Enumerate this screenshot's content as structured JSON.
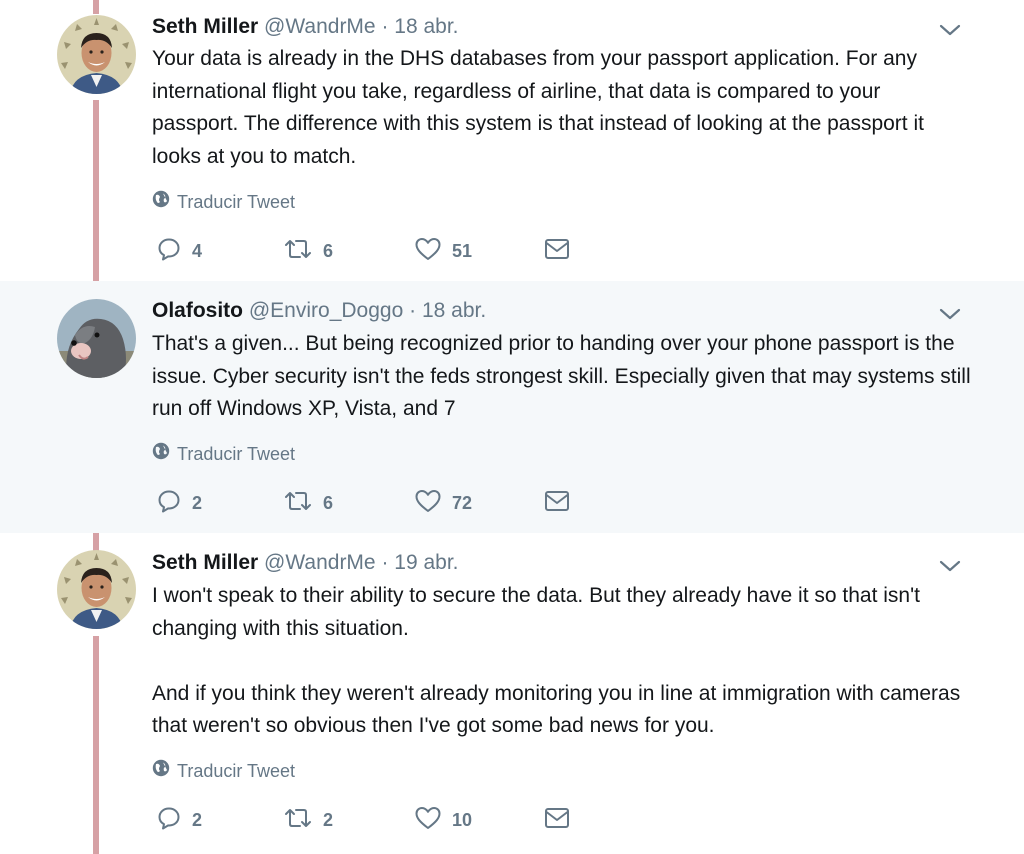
{
  "tweets": [
    {
      "name": "Seth Miller",
      "handle": "@WandrMe",
      "separator": "·",
      "date": "18 abr.",
      "text": [
        "Your data is already in the DHS databases from your passport application. For any international flight you take, regardless of airline, that data is compared to your passport. The difference with this system is that instead of looking at the passport it looks at you to match."
      ],
      "translate": "Traducir Tweet",
      "replies": "4",
      "retweets": "6",
      "likes": "51"
    },
    {
      "name": "Olafosito",
      "handle": "@Enviro_Doggo",
      "separator": "·",
      "date": "18 abr.",
      "text": [
        "That's a given... But being recognized prior to handing over your phone passport is the issue. Cyber security isn't the feds strongest skill. Especially given that may systems still run off Windows XP, Vista, and 7"
      ],
      "translate": "Traducir Tweet",
      "replies": "2",
      "retweets": "6",
      "likes": "72"
    },
    {
      "name": "Seth Miller",
      "handle": "@WandrMe",
      "separator": "·",
      "date": "19 abr.",
      "text": [
        "I won't speak to their ability to secure the data. But they already have it so that isn't changing with this situation.",
        "And if you think they weren't already monitoring you in line at immigration with cameras that weren't so obvious then I've got some bad news for you."
      ],
      "translate": "Traducir Tweet",
      "replies": "2",
      "retweets": "2",
      "likes": "10"
    }
  ],
  "icons": {
    "reply": "reply-icon",
    "retweet": "retweet-icon",
    "like": "heart-icon",
    "dm": "envelope-icon",
    "translate": "globe-icon",
    "caret": "chevron-down-icon"
  },
  "colors": {
    "thread_line": "#d6a1a5",
    "secondary_text": "#657786",
    "highlight_bg": "#f5f8fa"
  }
}
